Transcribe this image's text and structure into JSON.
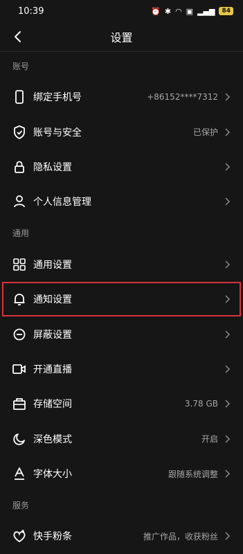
{
  "status": {
    "time": "10:39",
    "battery": "84"
  },
  "header": {
    "title": "设置"
  },
  "sections": {
    "account": "账号",
    "general": "通用",
    "service": "服务"
  },
  "rows": {
    "bind_phone": {
      "label": "绑定手机号",
      "value": "+86152****7312"
    },
    "account_security": {
      "label": "账号与安全",
      "value": "已保护"
    },
    "privacy": {
      "label": "隐私设置"
    },
    "personal_info": {
      "label": "个人信息管理"
    },
    "general_settings": {
      "label": "通用设置"
    },
    "notifications": {
      "label": "通知设置"
    },
    "block": {
      "label": "屏蔽设置"
    },
    "live": {
      "label": "开通直播"
    },
    "storage": {
      "label": "存储空间",
      "value": "3.78 GB"
    },
    "dark_mode": {
      "label": "深色模式",
      "value": "开启"
    },
    "font_size": {
      "label": "字体大小",
      "value": "跟随系统调整"
    },
    "fans": {
      "label": "快手粉条",
      "value": "推广作品，收获粉丝"
    }
  },
  "colors": {
    "background": "#161616",
    "highlight": "#d9333a"
  }
}
